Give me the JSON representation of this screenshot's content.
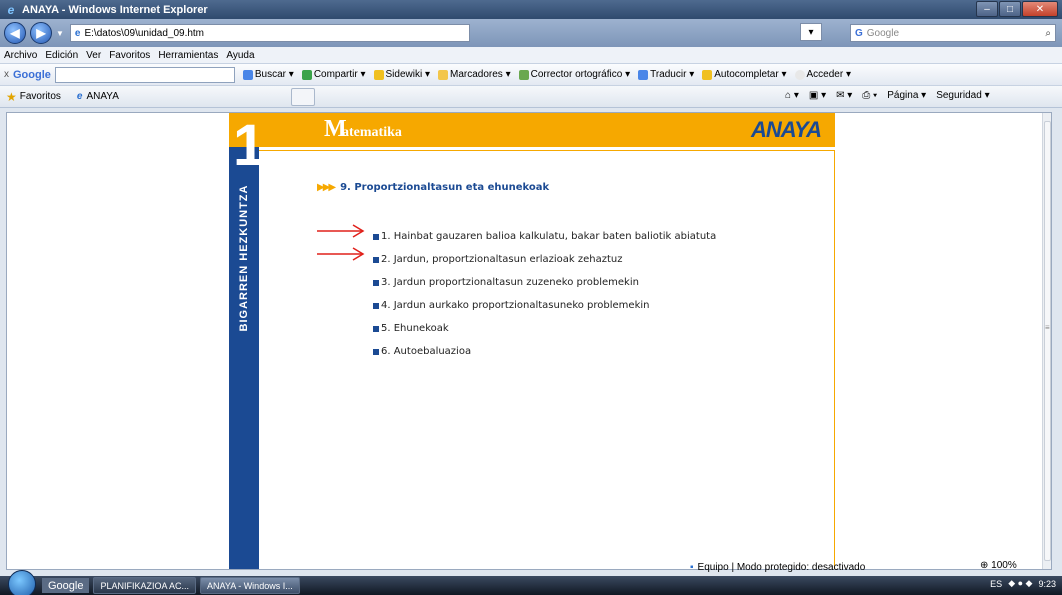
{
  "window": {
    "title": "ANAYA - Windows Internet Explorer"
  },
  "address": {
    "url": "E:\\datos\\09\\unidad_09.htm",
    "search_placeholder": "Google"
  },
  "menu": [
    "Archivo",
    "Edición",
    "Ver",
    "Favoritos",
    "Herramientas",
    "Ayuda"
  ],
  "google_toolbar": {
    "label": "Google",
    "items": [
      "Buscar ▾",
      "Compartir ▾",
      "Sidewiki ▾",
      "Marcadores ▾",
      "Corrector ortográfico ▾",
      "Traducir ▾",
      "Autocompletar ▾",
      "Acceder ▾"
    ]
  },
  "favorites": {
    "label": "Favoritos",
    "tab": "ANAYA",
    "commands": [
      "Página ▾",
      "Seguridad ▾"
    ]
  },
  "page": {
    "unit_number": "1",
    "spine_text": "BIGARREN HEZKUNTZA",
    "header_initial": "M",
    "header_rest": "atematika",
    "brand": "ANAYA",
    "section_title": "9. Proportzionaltasun eta ehunekoak",
    "items": [
      "1. Hainbat gauzaren balioa kalkulatu, bakar baten baliotik abiatuta",
      "2. Jardun, proportzionaltasun erlazioak zehaztuz",
      "3. Jardun proportzionaltasun zuzeneko problemekin",
      "4. Jardun aurkako proportzionaltasuneko problemekin",
      "5. Ehunekoak",
      "6. Autoebaluazioa"
    ]
  },
  "status": {
    "zone": "Equipo | Modo protegido: desactivado",
    "zoom": "100%"
  },
  "taskbar": {
    "google": "Google",
    "items": [
      "PLANIFIKAZIOA AC...",
      "ANAYA - Windows I..."
    ],
    "tray_lang": "ES",
    "clock": "9:23"
  },
  "colors": {
    "brand_blue": "#1b4a93",
    "brand_orange": "#f6a800",
    "annotation_red": "#e0201a"
  }
}
